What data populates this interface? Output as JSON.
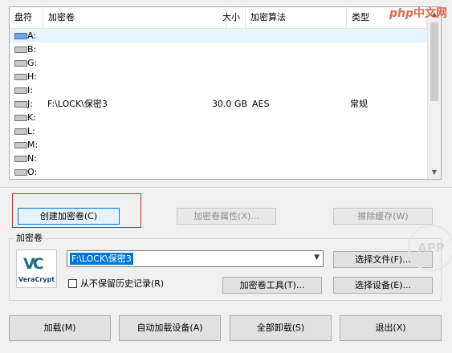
{
  "list": {
    "headers": {
      "drive": "盘符",
      "volume": "加密卷",
      "size": "大小",
      "algorithm": "加密算法",
      "type": "类型"
    },
    "rows": [
      {
        "drive": "A:",
        "volume": "",
        "size": "",
        "algorithm": "",
        "type": ""
      },
      {
        "drive": "B:",
        "volume": "",
        "size": "",
        "algorithm": "",
        "type": ""
      },
      {
        "drive": "G:",
        "volume": "",
        "size": "",
        "algorithm": "",
        "type": ""
      },
      {
        "drive": "H:",
        "volume": "",
        "size": "",
        "algorithm": "",
        "type": ""
      },
      {
        "drive": "I:",
        "volume": "",
        "size": "",
        "algorithm": "",
        "type": ""
      },
      {
        "drive": "J:",
        "volume": "F:\\LOCK\\保密3",
        "size": "30.0 GB",
        "algorithm": "AES",
        "type": "常规"
      },
      {
        "drive": "K:",
        "volume": "",
        "size": "",
        "algorithm": "",
        "type": ""
      },
      {
        "drive": "L:",
        "volume": "",
        "size": "",
        "algorithm": "",
        "type": ""
      },
      {
        "drive": "M:",
        "volume": "",
        "size": "",
        "algorithm": "",
        "type": ""
      },
      {
        "drive": "N:",
        "volume": "",
        "size": "",
        "algorithm": "",
        "type": ""
      },
      {
        "drive": "O:",
        "volume": "",
        "size": "",
        "algorithm": "",
        "type": ""
      }
    ],
    "selected_index": 0
  },
  "actions": {
    "create_volume": "创建加密卷(C)",
    "volume_properties": "加密卷属性(X)...",
    "wipe_cache": "擦除缓存(W)"
  },
  "volume_group": {
    "label": "加密卷",
    "logo_text": "VeraCrypt",
    "path_value": "F:\\LOCK\\保密3",
    "select_file": "选择文件(F)...",
    "never_save_history": "从不保留历史记录(R)",
    "volume_tools": "加密卷工具(T)...",
    "select_device": "选择设备(E)..."
  },
  "bottom": {
    "mount": "加载(M)",
    "auto_mount": "自动加载设备(A)",
    "dismount_all": "全部卸载(S)",
    "exit": "退出(X)"
  },
  "watermark": {
    "php": "php",
    "site": "中文网",
    "app": "APP"
  },
  "colors": {
    "selection": "#0078d7",
    "highlight_box": "#e02020",
    "row_selected": "#e5f3ff"
  }
}
